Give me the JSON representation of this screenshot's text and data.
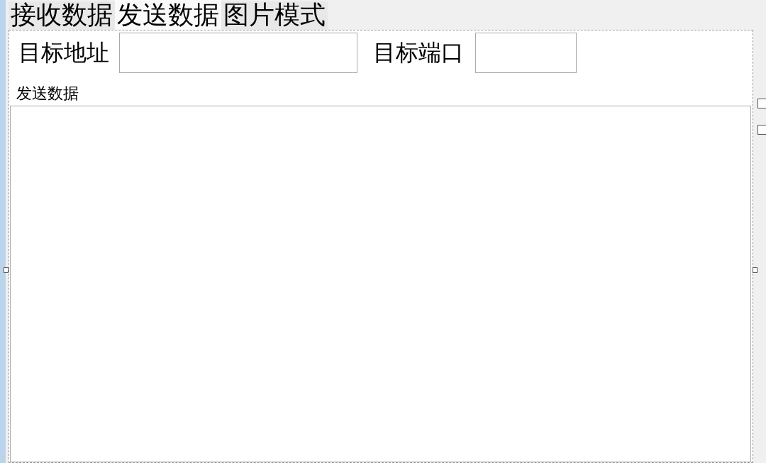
{
  "tabs": [
    {
      "label": "接收数据",
      "selected": false
    },
    {
      "label": "发送数据",
      "selected": true
    },
    {
      "label": "图片模式",
      "selected": false
    }
  ],
  "target_address": {
    "label": "目标地址"
  },
  "target_port": {
    "label": "目标端口"
  },
  "send_data": {
    "label": "发送数据"
  },
  "side_checkboxes": [
    {
      "checked": false
    },
    {
      "checked": false
    }
  ]
}
